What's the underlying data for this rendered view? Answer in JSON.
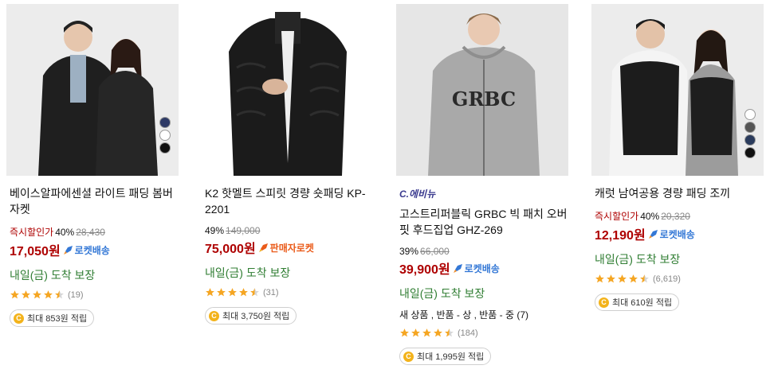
{
  "colors": {
    "price": "#ae0000",
    "promo": "#ae0000",
    "rocket_blue": "#3478d6",
    "rocket_orange": "#ea5b1a",
    "delivery": "#2f7d32",
    "star": "#f5a623"
  },
  "products": [
    {
      "image_alt": "couple wearing black padded bomber jackets",
      "brand": "",
      "title": "베이스알파에센셜 라이트 패딩 봄버 자켓",
      "promo_label": "즉시할인가",
      "discount": "40%",
      "original_price": "28,430",
      "price": "17,050원",
      "rocket": "로켓배송",
      "delivery": "내일(금) 도착 보장",
      "option": "",
      "rating": 4.5,
      "review_count": "(19)",
      "reward": "최대 853원 적립"
    },
    {
      "image_alt": "man wearing black quilted down jacket",
      "brand": "",
      "title": "K2 핫멜트 스피릿 경량 숏패딩 KP-2201",
      "promo_label": "",
      "discount": "49%",
      "original_price": "149,000",
      "price": "75,000원",
      "rocket": "판매자로켓",
      "delivery": "내일(금) 도착 보장",
      "option": "",
      "rating": 4.5,
      "review_count": "(31)",
      "reward": "최대 3,750원 적립"
    },
    {
      "image_alt": "man wearing grey GRBC zip hoodie",
      "brand": "C.에비뉴",
      "title": "고스트리퍼블릭 GRBC 빅 패치 오버핏 후드집업 GHZ-269",
      "promo_label": "",
      "discount": "39%",
      "original_price": "66,000",
      "price": "39,900원",
      "rocket": "로켓배송",
      "delivery": "내일(금) 도착 보장",
      "option": "새 상품 , 반품 - 상 , 반품 - 중 (7)",
      "rating": 4.5,
      "review_count": "(184)",
      "reward": "최대 1,995원 적립"
    },
    {
      "image_alt": "couple wearing black padded vests",
      "brand": "",
      "title": "캐럿 남여공용 경량 패딩 조끼",
      "promo_label": "즉시할인가",
      "discount": "40%",
      "original_price": "20,320",
      "price": "12,190원",
      "rocket": "로켓배송",
      "delivery": "내일(금) 도착 보장",
      "option": "",
      "rating": 4.5,
      "review_count": "(6,619)",
      "reward": "최대 610원 적립"
    }
  ]
}
